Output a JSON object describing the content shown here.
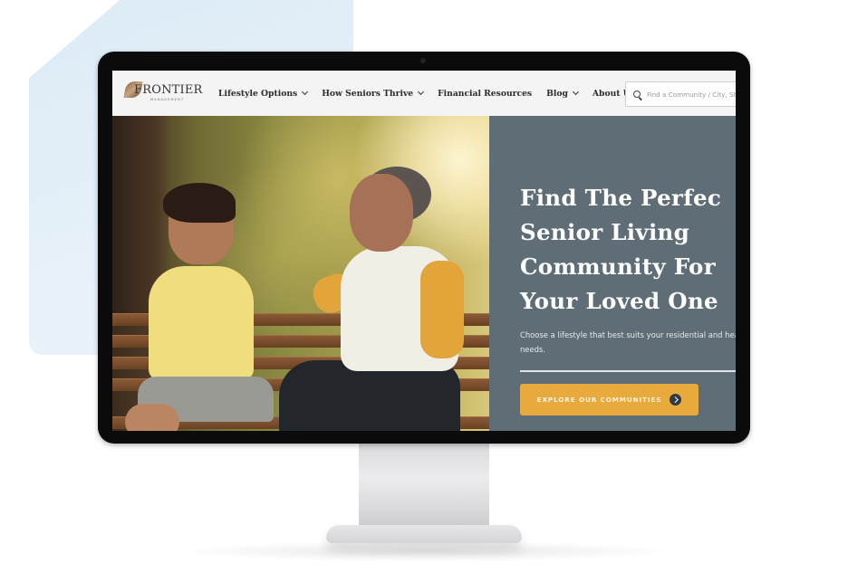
{
  "site": {
    "logo_text": "FRONTIER",
    "logo_subtext": "MANAGEMENT"
  },
  "nav": {
    "items": [
      {
        "label": "Lifestyle Options",
        "has_dropdown": true
      },
      {
        "label": "How Seniors Thrive",
        "has_dropdown": true
      },
      {
        "label": "Financial Resources",
        "has_dropdown": false
      },
      {
        "label": "Blog",
        "has_dropdown": true
      },
      {
        "label": "About Us",
        "has_dropdown": true
      }
    ],
    "search_placeholder": "Find a Community / City, St"
  },
  "hero": {
    "title_lines": [
      "Find The Perfec",
      "Senior Living",
      "Community For",
      "Your Loved One"
    ],
    "subtitle": "Choose a lifestyle that best suits your residential and heal needs.",
    "cta_label": "EXPLORE OUR COMMUNITIES",
    "image_alt": "Grandmother and grandson laughing on a park bench"
  },
  "colors": {
    "panel": "#5f6e76",
    "cta": "#e8a93d",
    "nav_bg": "#f4f4f4",
    "bezel": "#0b0b0c"
  }
}
